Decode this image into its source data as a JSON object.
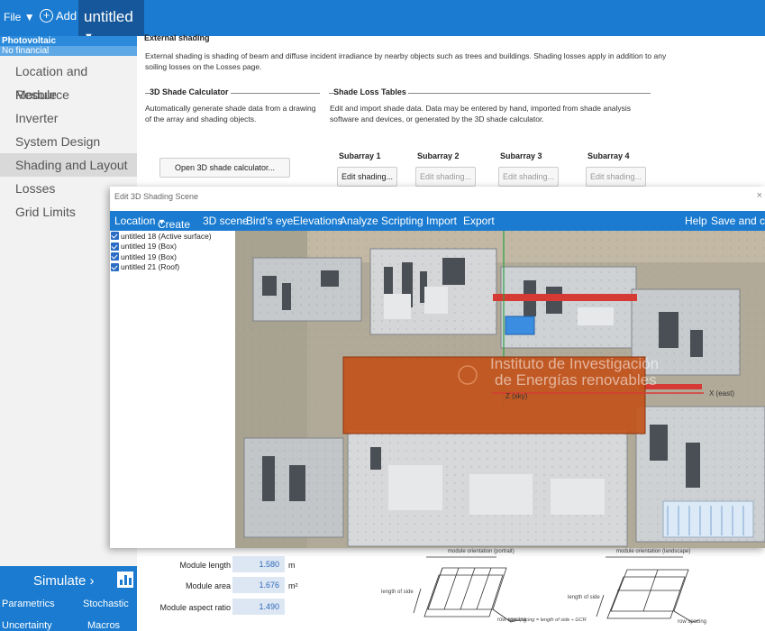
{
  "topbar": {
    "file_label": "File",
    "add_label": "Add",
    "doc_title": "untitled"
  },
  "sidebar": {
    "technology": "Photovoltaic",
    "financial": "No financial",
    "items": [
      {
        "label": "Location and Resource"
      },
      {
        "label": "Module"
      },
      {
        "label": "Inverter"
      },
      {
        "label": "System Design"
      },
      {
        "label": "Shading and Layout",
        "active": true
      },
      {
        "label": "Losses"
      },
      {
        "label": "Grid Limits"
      }
    ],
    "simulate_label": "Simulate",
    "parametrics_label": "Parametrics",
    "stochastic_label": "Stochastic",
    "uncertainty_label": "Uncertainty",
    "macros_label": "Macros"
  },
  "main": {
    "section_title": "External shading",
    "description": "External shading is shading of beam and diffuse incident irradiance by nearby objects such as trees and buildings. Shading losses apply in addition to any soiling losses on the Losses page.",
    "calc_title": "3D Shade Calculator",
    "calc_desc": "Automatically generate shade data from a drawing of the array and shading objects.",
    "loss_title": "Shade Loss Tables",
    "loss_desc": "Edit and import shade data. Data may be entered by hand, imported from shade analysis software and devices, or generated by the 3D shade calculator.",
    "open_calc_button": "Open 3D shade calculator...",
    "subarrays": [
      {
        "label": "Subarray 1",
        "button": "Edit shading...",
        "enabled": true
      },
      {
        "label": "Subarray 2",
        "button": "Edit shading...",
        "enabled": false
      },
      {
        "label": "Subarray 3",
        "button": "Edit shading...",
        "enabled": false
      },
      {
        "label": "Subarray 4",
        "button": "Edit shading...",
        "enabled": false
      }
    ]
  },
  "dialog": {
    "title": "Edit 3D Shading Scene",
    "close_glyph": "×",
    "menu": [
      "Location",
      "Create",
      "3D scene",
      "Bird's eye",
      "Elevations",
      "Analyze",
      "Scripting",
      "Import",
      "Export"
    ],
    "help_label": "Help",
    "save_close_label": "Save and clos",
    "objects": [
      {
        "label": "untitled 18 (Active surface)",
        "checked": true
      },
      {
        "label": "untitled 19 (Box)",
        "checked": true
      },
      {
        "label": "untitled 19 (Box)",
        "checked": true
      },
      {
        "label": "untitled 21 (Roof)",
        "checked": true
      }
    ],
    "scene": {
      "overlay_text_line1": "Instituto de Investigación",
      "overlay_text_line2": "de Energías renovables",
      "axis_z_label": "Z (sky)",
      "axis_x_label": "X (east)",
      "colors": {
        "surface": "#c2531a",
        "roof_red": "#d63a34",
        "panel_blue": "#3a8de0",
        "axis_green": "#2ea043"
      }
    }
  },
  "module_dims": {
    "length_label": "Module length",
    "length_value": "1.580",
    "length_unit": "m",
    "area_label": "Module area",
    "area_value": "1.676",
    "area_unit": "m²",
    "aspect_label": "Module aspect ratio",
    "aspect_value": "1.490"
  },
  "diagrams": {
    "portrait_title": "module orientation (portrait)",
    "landscape_title": "module orientation (landscape)",
    "length_of_side": "length of side",
    "row_spacing": "row spacing",
    "formula": "row spacing = length of side ÷ GCR"
  }
}
